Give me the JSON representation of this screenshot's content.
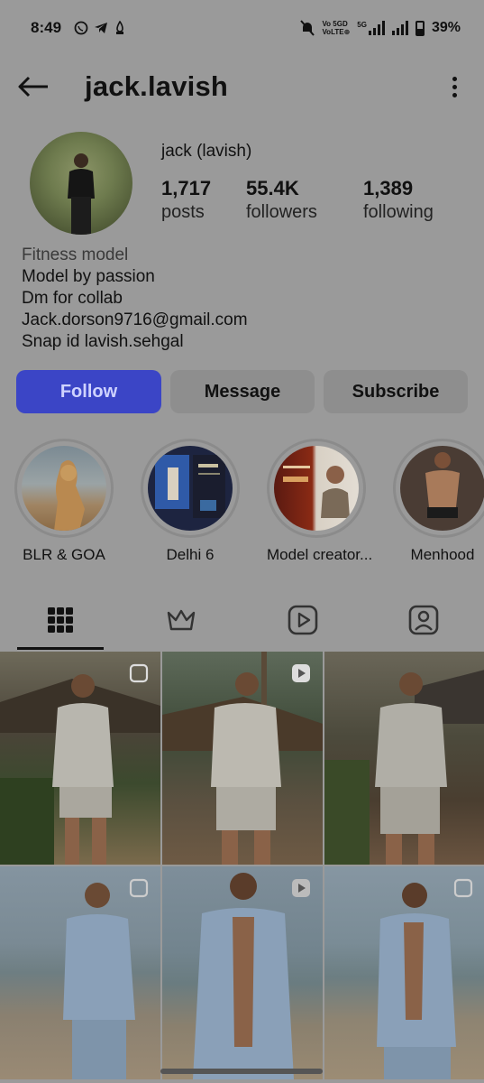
{
  "status_bar": {
    "time": "8:49",
    "network_line1": "Vo 5GD",
    "network_line2": "VoLTE⊕",
    "network_type": "5G",
    "battery": "39%"
  },
  "header": {
    "username": "jack.lavish"
  },
  "profile": {
    "full_name": "jack (lavish)",
    "stats": [
      {
        "value": "1,717",
        "label": "posts"
      },
      {
        "value": "55.4K",
        "label": "followers"
      },
      {
        "value": "1,389",
        "label": "following"
      }
    ],
    "bio": {
      "category": "Fitness model",
      "lines": [
        "Model by passion",
        "Dm for collab",
        "Jack.dorson9716@gmail.com",
        "Snap id lavish.sehgal"
      ]
    }
  },
  "actions": {
    "follow": "Follow",
    "message": "Message",
    "subscribe": "Subscribe"
  },
  "highlights": [
    {
      "label": "BLR & GOA"
    },
    {
      "label": "Delhi 6"
    },
    {
      "label": "Model creator..."
    },
    {
      "label": "Menhood"
    }
  ],
  "tabs": [
    {
      "name": "grid-icon",
      "active": true
    },
    {
      "name": "crown-icon",
      "active": false
    },
    {
      "name": "reels-icon",
      "active": false
    },
    {
      "name": "tagged-icon",
      "active": false
    }
  ],
  "colors": {
    "background": "#9a9a9a",
    "follow_button": "#3b45c6",
    "secondary_button": "#8e8e8e"
  }
}
